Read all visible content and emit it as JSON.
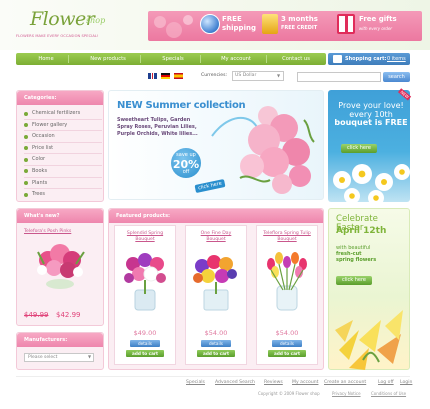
{
  "header": {
    "logo_title": "Flower",
    "logo_sub": "shop",
    "tagline": "FLOWERS MAKE EVERY OCCASION SPECIAL!",
    "promos": [
      {
        "title": "FREE",
        "title2": "shipping"
      },
      {
        "title": "3 months",
        "title2": "FREE CREDIT"
      },
      {
        "title": "Free gifts",
        "title2": "with every order"
      }
    ]
  },
  "nav": {
    "items": [
      "Home",
      "New products",
      "Specials",
      "My account",
      "Contact us"
    ]
  },
  "cart": {
    "label": "Shopping cart:",
    "items": "0 items"
  },
  "toolbar": {
    "currencies_label": "Currencies:",
    "currency_value": "US Dollar",
    "search_button": "search"
  },
  "categories": {
    "title": "Categories:",
    "items": [
      "Chemical fertilizers",
      "Flower gallery",
      "Occasion",
      "Price list",
      "Color",
      "Books",
      "Plants",
      "Trees"
    ]
  },
  "whats_new": {
    "title": "What's new?",
    "product_name": "Telefora's Posh Pinks",
    "old_price": "$49.99",
    "new_price": "$42.99"
  },
  "manufacturers": {
    "title": "Manufacturers:",
    "select_value": "Please select"
  },
  "hero": {
    "title": "NEW Summer collection",
    "lines": [
      "Sweetheart Tulips, Garden",
      "Spray Roses, Peruvian Lilies,",
      "Purple Orchids, White lilies..."
    ],
    "discount_top": "save up",
    "discount_pct": "20%",
    "discount_off": "off",
    "click": "click here"
  },
  "featured": {
    "title": "Featured products:",
    "products": [
      {
        "name_l1": "Splendid Spring",
        "name_l2": "Bouquet",
        "price": "$49.00"
      },
      {
        "name_l1": "One Fine Day",
        "name_l2": "Bouquet",
        "price": "$54.00"
      },
      {
        "name_l1": "Teleflora Spring Tulip",
        "name_l2": "Bouquet",
        "price": "$54.00"
      }
    ],
    "details_label": "details",
    "cart_label": "add to cart"
  },
  "banner_bouquet": {
    "line1": "Prove your love!",
    "line2": "every 10th",
    "line3": "bouquet is FREE",
    "click": "click here",
    "new_tag": "NEW"
  },
  "banner_easter": {
    "line1": "Celebrate Easter",
    "line2": "April 12th",
    "sub1": "with beautiful",
    "sub2": "fresh-cut",
    "sub3": "spring flowers",
    "click": "click here"
  },
  "footer": {
    "links": [
      "Specials",
      "Advanced Search",
      "Reviews",
      "My account",
      "Create an account",
      "Log off",
      "Login"
    ],
    "copyright": "Copyright © 2009 Flower shop",
    "privacy": "Privacy Notice",
    "conditions": "Conditions of Use"
  },
  "colors": {
    "accent_green": "#7cae33",
    "accent_pink": "#ee86ad",
    "accent_blue": "#3e7dbb"
  }
}
